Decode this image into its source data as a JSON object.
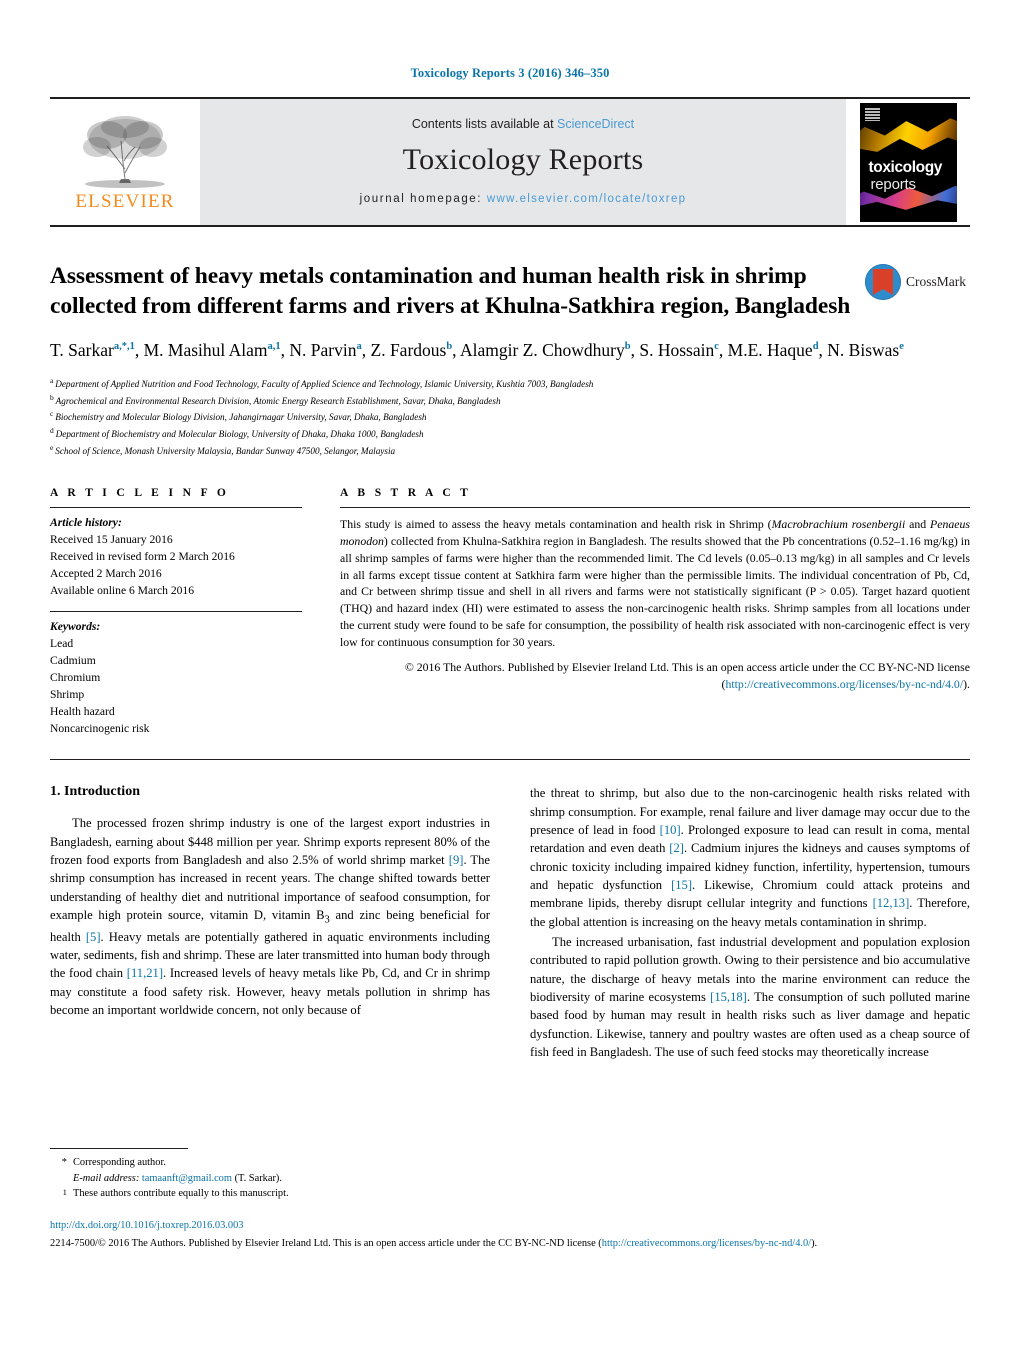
{
  "running_head": "Toxicology Reports 3 (2016) 346–350",
  "masthead": {
    "publisher_name": "ELSEVIER",
    "contents_prefix": "Contents lists available at ",
    "contents_link": "ScienceDirect",
    "journal_title": "Toxicology Reports",
    "homepage_label": "journal homepage:",
    "homepage_url": "www.elsevier.com/locate/toxrep",
    "cover_title_line1": "toxicology",
    "cover_title_line2": "reports"
  },
  "article": {
    "title": "Assessment of heavy metals contamination and human health risk in shrimp collected from different farms and rivers at Khulna-Satkhira region, Bangladesh",
    "crossmark_label": "CrossMark",
    "authors": [
      {
        "name": "T. Sarkar",
        "marks": "a,*,1"
      },
      {
        "name": "M. Masihul Alam",
        "marks": "a,1"
      },
      {
        "name": "N. Parvin",
        "marks": "a"
      },
      {
        "name": "Z. Fardous",
        "marks": "b"
      },
      {
        "name": "Alamgir Z. Chowdhury",
        "marks": "b"
      },
      {
        "name": "S. Hossain",
        "marks": "c"
      },
      {
        "name": "M.E. Haque",
        "marks": "d"
      },
      {
        "name": "N. Biswas",
        "marks": "e"
      }
    ],
    "affiliations": [
      {
        "mark": "a",
        "text": "Department of Applied Nutrition and Food Technology, Faculty of Applied Science and Technology, Islamic University, Kushtia 7003, Bangladesh"
      },
      {
        "mark": "b",
        "text": "Agrochemical and Environmental Research Division, Atomic Energy Research Establishment, Savar, Dhaka, Bangladesh"
      },
      {
        "mark": "c",
        "text": "Biochemistry and Molecular Biology Division, Jahangirnagar University, Savar, Dhaka, Bangladesh"
      },
      {
        "mark": "d",
        "text": "Department of Biochemistry and Molecular Biology, University of Dhaka, Dhaka 1000, Bangladesh"
      },
      {
        "mark": "e",
        "text": "School of Science, Monash University Malaysia, Bandar Sunway 47500, Selangor, Malaysia"
      }
    ]
  },
  "article_info": {
    "heading": "A R T I C L E   I N F O",
    "history_label": "Article history:",
    "history": [
      "Received 15 January 2016",
      "Received in revised form 2 March 2016",
      "Accepted 2 March 2016",
      "Available online 6 March 2016"
    ],
    "keywords_label": "Keywords:",
    "keywords": [
      "Lead",
      "Cadmium",
      "Chromium",
      "Shrimp",
      "Health hazard",
      "Noncarcinogenic risk"
    ]
  },
  "abstract": {
    "heading": "A B S T R A C T",
    "paragraph_part1": "This study is aimed to assess the heavy metals contamination and health risk in Shrimp (",
    "species1": "Macrobrachium rosenbergii",
    "and_word": " and ",
    "species2": "Penaeus monodon",
    "paragraph_part2": ") collected from Khulna-Satkhira region in Bangladesh. The results showed that the Pb concentrations (0.52–1.16 mg/kg) in all shrimp samples of farms were higher than the recommended limit. The Cd levels (0.05–0.13 mg/kg) in all samples and Cr levels in all farms except tissue content at Satkhira farm were higher than the permissible limits. The individual concentration of Pb, Cd, and Cr between shrimp tissue and shell in all rivers and farms were not statistically significant (P > 0.05). Target hazard quotient (THQ) and hazard index (HI) were estimated to assess the non-carcinogenic health risks. Shrimp samples from all locations under the current study were found to be safe for consumption, the possibility of health risk associated with non-carcinogenic effect is very low for continuous consumption for 30 years.",
    "copyright_text": "© 2016 The Authors. Published by Elsevier Ireland Ltd. This is an open access article under the CC BY-NC-ND license (",
    "copyright_link": "http://creativecommons.org/licenses/by-nc-nd/4.0/",
    "copyright_tail": ")."
  },
  "body": {
    "section_heading": "1.  Introduction",
    "left_column": [
      "The processed frozen shrimp industry is one of the largest export industries in Bangladesh, earning about $448 million per year. Shrimp exports represent 80% of the frozen food exports from Bangladesh and also 2.5% of world shrimp market [9]. The shrimp consumption has increased in recent years. The change shifted towards better understanding of healthy diet and nutritional importance of seafood consumption, for example high protein source, vitamin D, vitamin B3 and zinc being beneficial for health [5]. Heavy metals are potentially gathered in aquatic environments including water, sediments, fish and shrimp. These are later transmitted into human body through the food chain [11,21]. Increased levels of heavy metals like Pb, Cd, and Cr in shrimp may constitute a food safety risk. However, heavy metals pollution in shrimp has become an important worldwide concern, not only because of"
    ],
    "right_column": [
      "the threat to shrimp, but also due to the non-carcinogenic health risks related with shrimp consumption. For example, renal failure and liver damage may occur due to the presence of lead in food [10]. Prolonged exposure to lead can result in coma, mental retardation and even death [2]. Cadmium injures the kidneys and causes symptoms of chronic toxicity including impaired kidney function, infertility, hypertension, tumours and hepatic dysfunction [15]. Likewise, Chromium could attack proteins and membrane lipids, thereby disrupt cellular integrity and functions [12,13]. Therefore, the global attention is increasing on the heavy metals contamination in shrimp.",
      "The increased urbanisation, fast industrial development and population explosion contributed to rapid pollution growth. Owing to their persistence and bio accumulative nature, the discharge of heavy metals into the marine environment can reduce the biodiversity of marine ecosystems [15,18]. The consumption of such polluted marine based food by human may result in health risks such as liver damage and hepatic dysfunction. Likewise, tannery and poultry wastes are often used as a cheap source of fish feed in Bangladesh. The use of such feed stocks may theoretically increase"
    ]
  },
  "footnotes": {
    "corresponding_mark": "*",
    "corresponding_text": "Corresponding author.",
    "email_label": "E-mail address:",
    "email": "tamaanft@gmail.com",
    "email_owner": "(T. Sarkar).",
    "equal_mark": "1",
    "equal_text": "These authors contribute equally to this manuscript."
  },
  "bottom": {
    "doi": "http://dx.doi.org/10.1016/j.toxrep.2016.03.003",
    "issn_line_part1": "2214-7500/© 2016 The Authors. Published by Elsevier Ireland Ltd. This is an open access article under the CC BY-NC-ND license (",
    "issn_link": "http://creativecommons.org/licenses/by-nc-nd/4.0/",
    "issn_line_part2": ")."
  },
  "colors": {
    "link": "#0b74a8",
    "elsevier_orange": "#f28b1e",
    "masthead_grey": "#e6e7e8"
  }
}
